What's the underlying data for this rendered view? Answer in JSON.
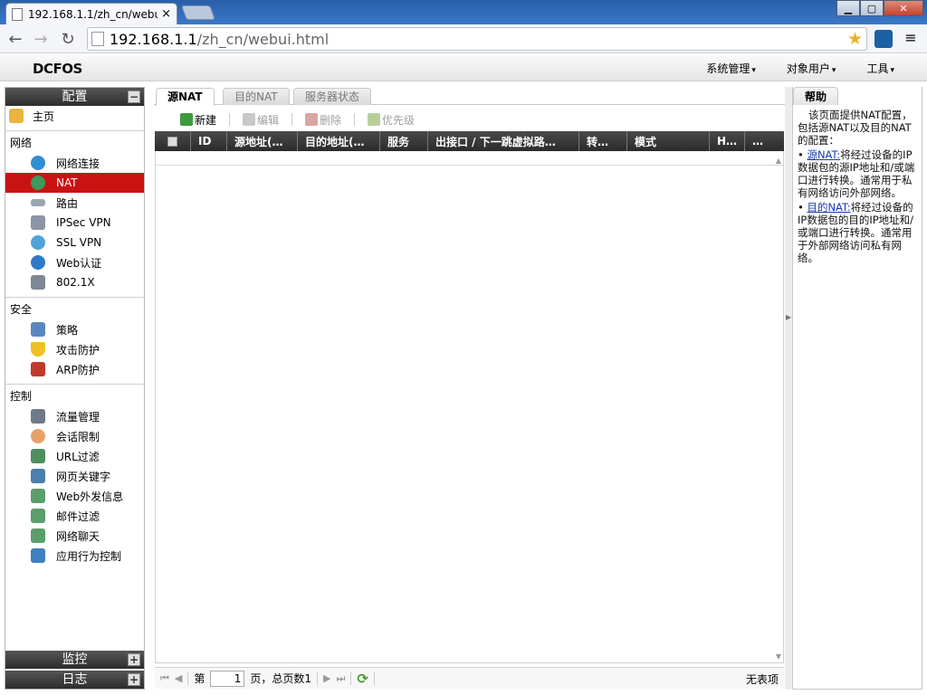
{
  "browser": {
    "tab_title": "192.168.1.1/zh_cn/webu",
    "tab_close": "×",
    "url_host": "192.168.1.1",
    "url_path": "/zh_cn/webui.html"
  },
  "app": {
    "logo": "DCFOS",
    "menus": [
      "系统管理",
      "对象用户",
      "工具"
    ]
  },
  "sidebar": {
    "config_header": "配置",
    "config_toggle": "−",
    "home": "主页",
    "groups": [
      {
        "title": "网络",
        "items": [
          "网络连接",
          "NAT",
          "路由",
          "IPSec VPN",
          "SSL VPN",
          "Web认证",
          "802.1X"
        ]
      },
      {
        "title": "安全",
        "items": [
          "策略",
          "攻击防护",
          "ARP防护"
        ]
      },
      {
        "title": "控制",
        "items": [
          "流量管理",
          "会话限制",
          "URL过滤",
          "网页关键字",
          "Web外发信息",
          "邮件过滤",
          "网络聊天",
          "应用行为控制"
        ]
      }
    ],
    "active_item": "NAT",
    "monitor_header": "监控",
    "log_header": "日志",
    "expand_toggle": "+"
  },
  "main": {
    "tabs": [
      "源NAT",
      "目的NAT",
      "服务器状态"
    ],
    "active_tab": "源NAT",
    "actions": {
      "new": "新建",
      "edit": "编辑",
      "delete": "删除",
      "priority": "优先级"
    },
    "columns": [
      "ID",
      "源地址(…",
      "目的地址(…",
      "服务",
      "出接口 / 下一跳虚拟路…",
      "转…",
      "模式",
      "H…",
      "…"
    ],
    "pager": {
      "page_prefix": "第",
      "page_value": "1",
      "page_suffix": "页，总页数1",
      "empty_text": "无表项"
    }
  },
  "help": {
    "tab_label": "帮助",
    "intro": "该页面提供NAT配置，包括源NAT以及目的NAT的配置：",
    "items": [
      {
        "link": "源NAT:",
        "text": "将经过设备的IP数据包的源IP地址和/或端口进行转换。通常用于私有网络访问外部网络。"
      },
      {
        "link": "目的NAT:",
        "text": "将经过设备的IP数据包的目的IP地址和/或端口进行转换。通常用于外部网络访问私有网络。"
      }
    ]
  },
  "colors": {
    "active_nav": "#c91313",
    "header_dark": "#2d2d2d",
    "link": "#1a3aa8"
  }
}
